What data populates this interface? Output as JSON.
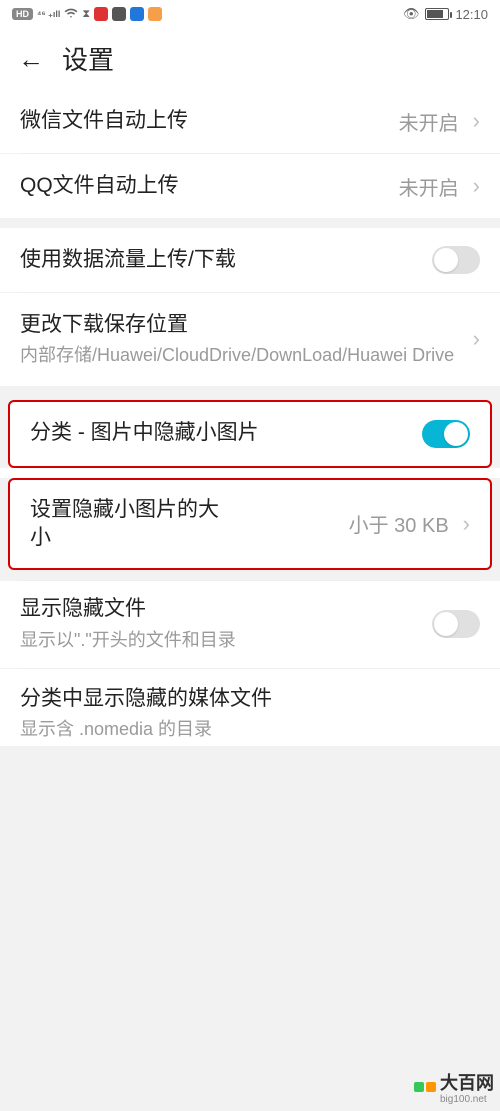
{
  "status": {
    "time": "12:10"
  },
  "header": {
    "title": "设置"
  },
  "rows": {
    "wechat_upload": {
      "title": "微信文件自动上传",
      "value": "未开启"
    },
    "qq_upload": {
      "title": "QQ文件自动上传",
      "value": "未开启"
    },
    "data_upload": {
      "title": "使用数据流量上传/下载",
      "toggle": false
    },
    "download_loc": {
      "title": "更改下载保存位置",
      "sub": "内部存储/Huawei/CloudDrive/DownLoad/Huawei Drive"
    },
    "hide_small": {
      "title": "分类 - 图片中隐藏小图片",
      "toggle": true
    },
    "hide_size": {
      "title": "设置隐藏小图片的大小",
      "value": "小于 30 KB"
    },
    "show_hidden": {
      "title": "显示隐藏文件",
      "sub": "显示以\".\"开头的文件和目录",
      "toggle": false
    },
    "show_media": {
      "title": "分类中显示隐藏的媒体文件",
      "sub": "显示含 .nomedia 的目录"
    }
  },
  "watermark": {
    "text": "大百网",
    "url": "big100.net"
  }
}
